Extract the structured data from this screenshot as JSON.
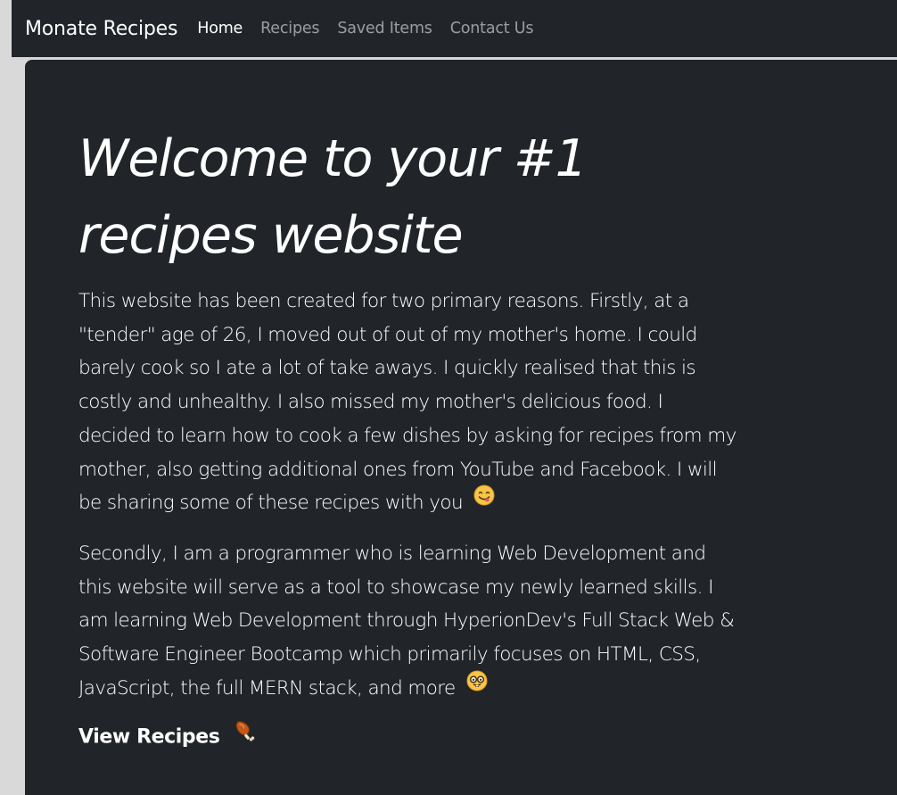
{
  "navbar": {
    "brand": "Monate Recipes",
    "links": [
      "Home",
      "Recipes",
      "Saved Items",
      "Contact Us"
    ],
    "active": "Home"
  },
  "hero": {
    "title": "Welcome to your #1 recipes website",
    "paragraphs": [
      "This website has been created for two primary reasons. Firstly, at a \"tender\" age of 26, I moved out of out of my mother's home. I could barely cook so I ate a lot of take aways. I quickly realised that this is costly and unhealthy. I also missed my mother's delicious food. I decided to learn how to cook a few dishes by asking for recipes from my mother, also getting additional ones from YouTube and Facebook. I will be sharing some of these recipes with you",
      "Secondly, I am a programmer who is learning Web Development and this website will serve as a tool to showcase my newly learned skills. I am learning Web Development through HyperionDev's Full Stack Web & Software Engineer Bootcamp which primarily focuses on HTML, CSS, JavaScript, the full MERN stack, and more"
    ],
    "cta_label": "View Recipes"
  },
  "icons": {
    "paragraph_1_emoji": "yum-face-icon",
    "paragraph_2_emoji": "nerd-face-icon",
    "cta_emoji": "drumstick-icon"
  },
  "colors": {
    "background": "#212529",
    "page": "#d9d9d9",
    "nav_active": "#ffffff",
    "nav_inactive": "rgba(255,255,255,0.55)",
    "text": "#ffffff"
  }
}
